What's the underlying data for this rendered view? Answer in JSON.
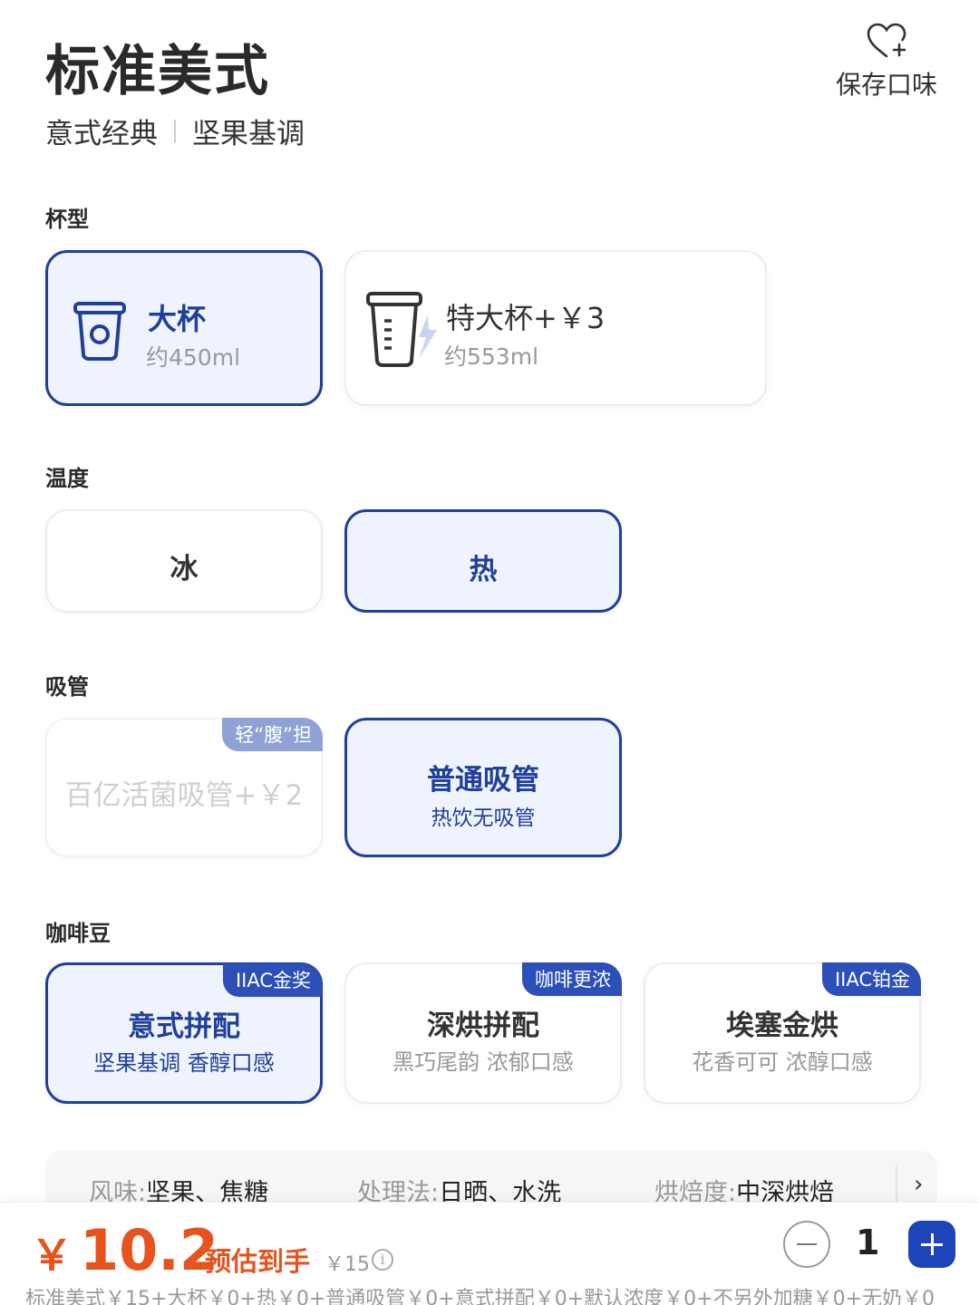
{
  "header": {
    "title": "标准美式",
    "tags": [
      "意式经典",
      "坚果基调"
    ],
    "save_label": "保存口味"
  },
  "cup": {
    "label": "杯型",
    "options": [
      {
        "name": "大杯",
        "volume": "约450ml",
        "selected": true
      },
      {
        "name": "特大杯+￥3",
        "volume": "约553ml",
        "selected": false
      }
    ]
  },
  "temperature": {
    "label": "温度",
    "options": [
      {
        "name": "冰",
        "selected": false
      },
      {
        "name": "热",
        "selected": true
      }
    ]
  },
  "straw": {
    "label": "吸管",
    "options": [
      {
        "name": "百亿活菌吸管+￥2",
        "badge": "轻“腹”担",
        "disabled": true,
        "selected": false
      },
      {
        "name": "普通吸管",
        "sub": "热饮无吸管",
        "selected": true
      }
    ]
  },
  "beans": {
    "label": "咖啡豆",
    "options": [
      {
        "name": "意式拼配",
        "sub": "坚果基调 香醇口感",
        "badge": "IIAC金奖",
        "selected": true
      },
      {
        "name": "深烘拼配",
        "sub": "黑巧尾韵 浓郁口感",
        "badge": "咖啡更浓",
        "selected": false
      },
      {
        "name": "埃塞金烘",
        "sub": "花香可可 浓醇口感",
        "badge": "IIAC铂金",
        "selected": false
      }
    ]
  },
  "bean_info": {
    "flavor_key": "风味:",
    "flavor_val": "坚果、焦糖",
    "process_key": "处理法:",
    "process_val": "日晒、水洗",
    "roast_key": "烘焙度:",
    "roast_val": "中深烘焙"
  },
  "bottom": {
    "currency": "￥",
    "price": "10.2",
    "estimate_label": "预估到手",
    "original_price": "￥15",
    "quantity": "1",
    "breakdown": "标准美式￥15+大杯￥0+热￥0+普通吸管￥0+意式拼配￥0+默认浓度￥0+不另外加糖￥0+无奶￥0"
  },
  "colors": {
    "accent": "#1f3f9a",
    "price": "#e8531d",
    "selected_bg": "#eef3fd"
  }
}
